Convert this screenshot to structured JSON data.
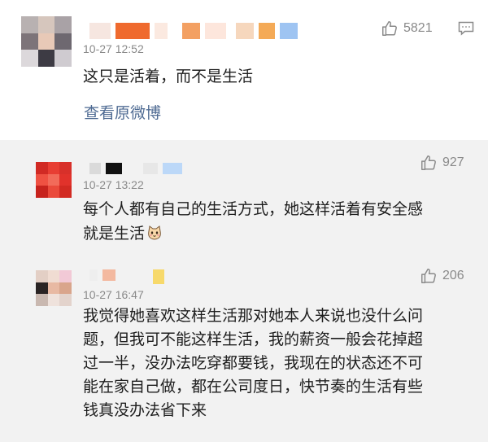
{
  "main_comment": {
    "time": "10-27 12:52",
    "text": "这只是活着，而不是生活",
    "link": "查看原微博",
    "likes": "5821",
    "like_icon": "thumbs-up-icon",
    "comment_icon": "comment-icon"
  },
  "replies": [
    {
      "time": "10-27 13:22",
      "text_line1": "每个人都有自己的生活方式，她这样活着有安全感",
      "text_line2": "就是生活",
      "emoji": "cat-emoji",
      "likes": "927"
    },
    {
      "time": "10-27 16:47",
      "lines": [
        "我觉得她喜欢这样生活那对她本人来说也没什么问",
        "题，但我可不能这样生活，我的薪资一般会花掉超",
        "过一半，没办法吃穿都要钱，我现在的状态还不可",
        "能在家自己做，都在公司度日，快节奏的生活有些",
        "钱真没办法省下来"
      ],
      "likes": "206"
    }
  ],
  "colors": {
    "link": "#4f6b93",
    "meta": "#8a8a8a",
    "reply_bg": "#f2f2f2"
  }
}
